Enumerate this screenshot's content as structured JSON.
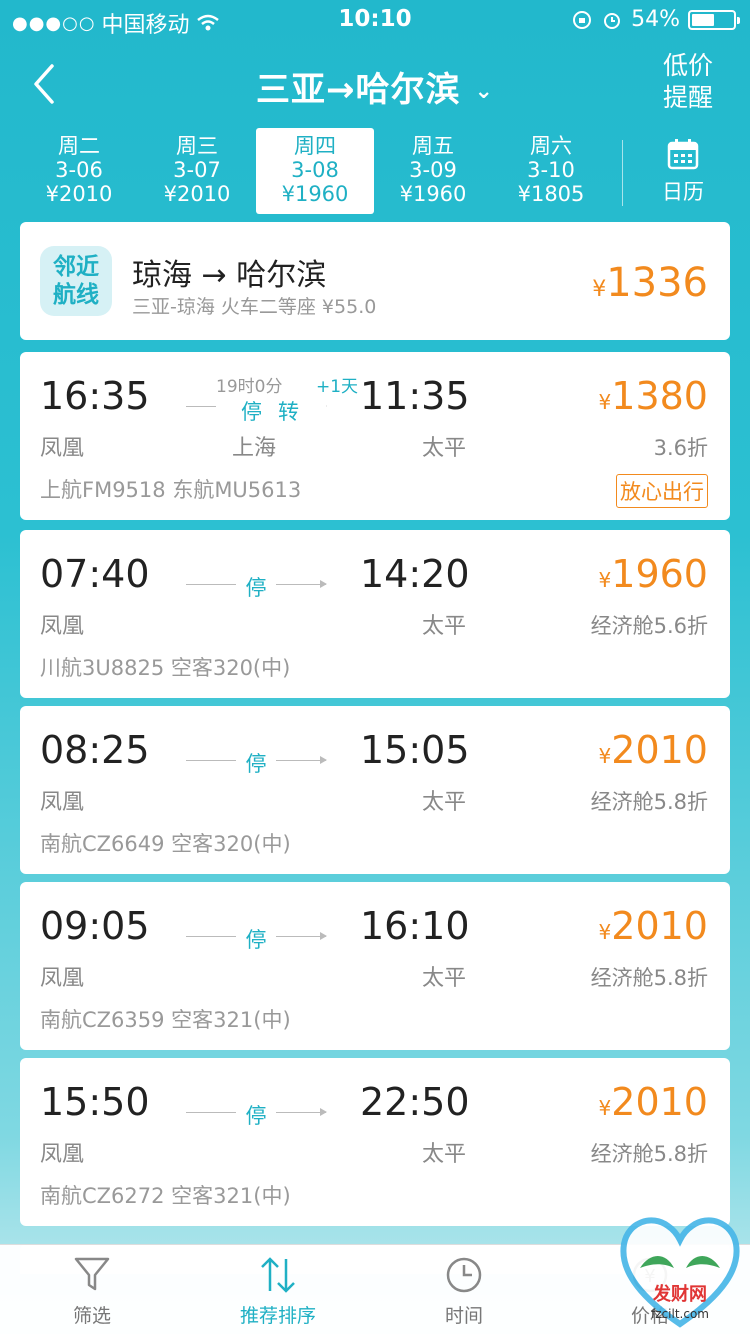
{
  "status_bar": {
    "signal": "●●●○○",
    "carrier": "中国移动",
    "time": "10:10",
    "battery_percent": "54%",
    "battery_level": 0.54
  },
  "nav": {
    "route": "三亚→哈尔滨",
    "low_price_line1": "低价",
    "low_price_line2": "提醒"
  },
  "dates": [
    {
      "weekday": "周二",
      "date": "3-06",
      "price": "¥2010",
      "active": false
    },
    {
      "weekday": "周三",
      "date": "3-07",
      "price": "¥2010",
      "active": false
    },
    {
      "weekday": "周四",
      "date": "3-08",
      "price": "¥1960",
      "active": true
    },
    {
      "weekday": "周五",
      "date": "3-09",
      "price": "¥1960",
      "active": false
    },
    {
      "weekday": "周六",
      "date": "3-10",
      "price": "¥1805",
      "active": false
    }
  ],
  "calendar_label": "日历",
  "nearby": {
    "badge_line1": "邻近",
    "badge_line2": "航线",
    "title": "琼海 → 哈尔滨",
    "subtitle": "三亚-琼海 火车二等座 ¥55.0",
    "currency": "¥",
    "price": "1336"
  },
  "transfer_flight": {
    "dep_time": "16:35",
    "arr_time": "11:35",
    "dep_airport": "凤凰",
    "arr_airport": "太平",
    "duration": "19时0分",
    "plus_day": "+1天",
    "stop_label": "停转",
    "transfer_city": "上海",
    "airlines": "上航FM9518 东航MU5613",
    "currency": "¥",
    "price": "1380",
    "discount": "3.6折",
    "badge": "放心出行"
  },
  "flights": [
    {
      "dep_time": "07:40",
      "arr_time": "14:20",
      "dep_airport": "凤凰",
      "arr_airport": "太平",
      "stop": "停",
      "airline": "川航3U8825 空客320(中)",
      "currency": "¥",
      "price": "1960",
      "cabin": "经济舱5.6折"
    },
    {
      "dep_time": "08:25",
      "arr_time": "15:05",
      "dep_airport": "凤凰",
      "arr_airport": "太平",
      "stop": "停",
      "airline": "南航CZ6649 空客320(中)",
      "currency": "¥",
      "price": "2010",
      "cabin": "经济舱5.8折"
    },
    {
      "dep_time": "09:05",
      "arr_time": "16:10",
      "dep_airport": "凤凰",
      "arr_airport": "太平",
      "stop": "停",
      "airline": "南航CZ6359 空客321(中)",
      "currency": "¥",
      "price": "2010",
      "cabin": "经济舱5.8折"
    },
    {
      "dep_time": "15:50",
      "arr_time": "22:50",
      "dep_airport": "凤凰",
      "arr_airport": "太平",
      "stop": "停",
      "airline": "南航CZ6272 空客321(中)",
      "currency": "¥",
      "price": "2010",
      "cabin": "经济舱5.8折"
    }
  ],
  "tabbar": {
    "filter": "筛选",
    "recommend": "推荐排序",
    "time": "时间",
    "price": "价格"
  },
  "watermark": {
    "text": "发财网",
    "url": "fzcilt.com"
  },
  "colors": {
    "accent": "#1fb0c4",
    "price": "#f28a1e",
    "background": "#22b8cc"
  }
}
